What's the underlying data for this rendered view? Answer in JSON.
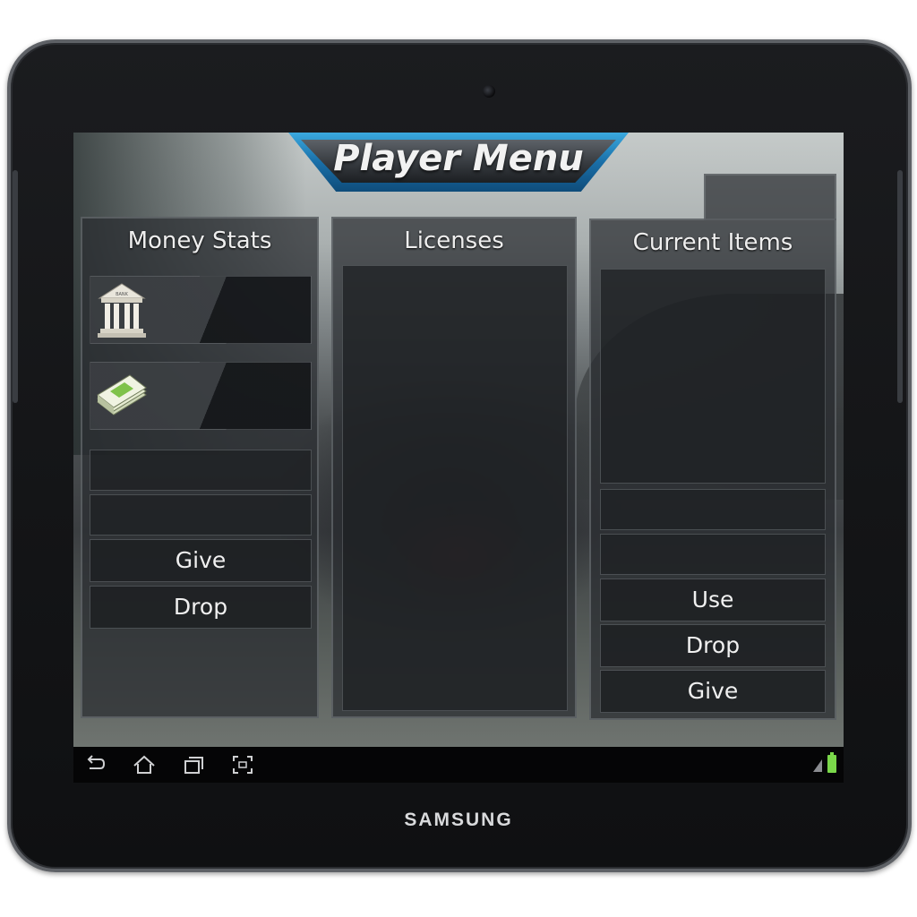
{
  "device": {
    "brand": "SAMSUNG"
  },
  "header": {
    "title": "Player Menu"
  },
  "panels": {
    "money": {
      "title": "Money Stats",
      "bank_icon": "bank-icon",
      "cash_icon": "cash-icon",
      "buttons": {
        "give": "Give",
        "drop": "Drop"
      }
    },
    "licenses": {
      "title": "Licenses"
    },
    "items": {
      "title": "Current Items",
      "buttons": {
        "use": "Use",
        "drop": "Drop",
        "give": "Give"
      }
    }
  },
  "navbar": {
    "icons": [
      "back-icon",
      "home-icon",
      "recent-apps-icon",
      "screenshot-icon"
    ],
    "status": {
      "signal": "signal-icon",
      "battery": "battery-icon",
      "battery_color": "#7ad84a"
    }
  },
  "colors": {
    "banner_blue": "#1a6fa8",
    "panel_border": "#787d82"
  }
}
